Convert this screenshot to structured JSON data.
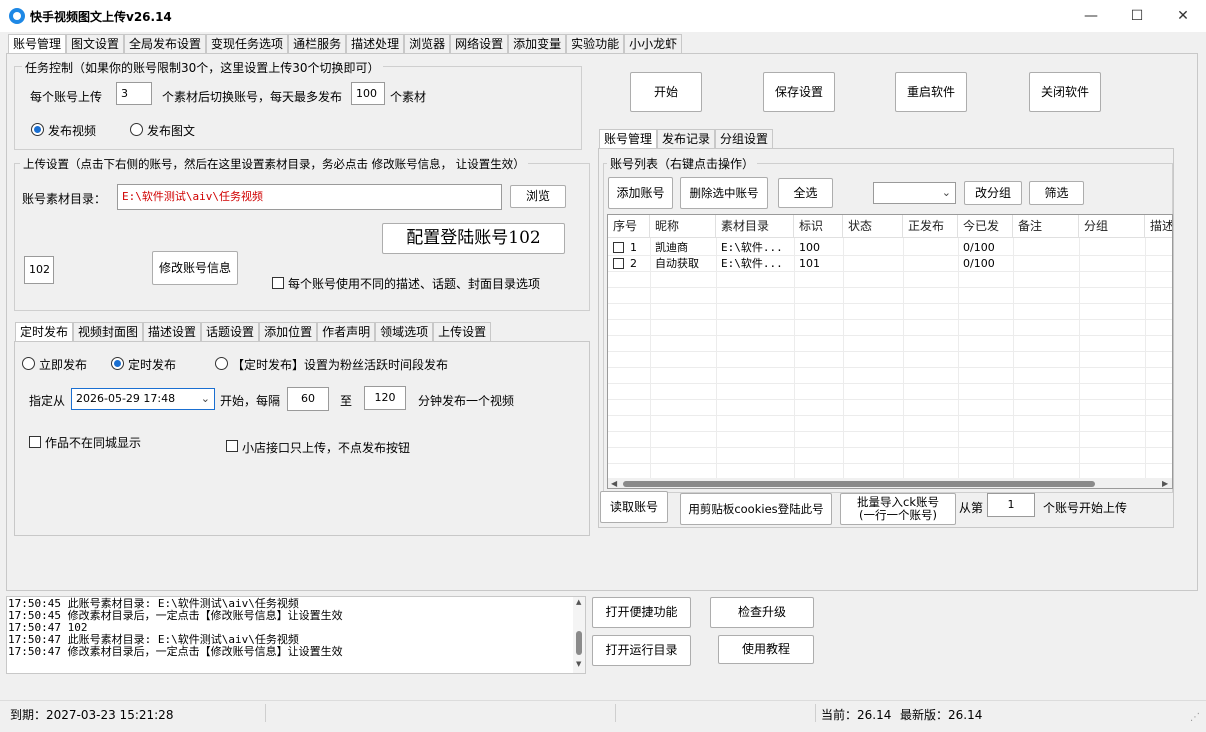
{
  "window": {
    "title": "快手视频图文上传v26.14",
    "minimize": "—",
    "maximize": "☐",
    "close": "✕"
  },
  "main_tabs": [
    "账号管理",
    "图文设置",
    "全局发布设置",
    "变现任务选项",
    "通栏服务",
    "描述处理",
    "浏览器",
    "网络设置",
    "添加变量",
    "实验功能",
    "小小龙虾"
  ],
  "task": {
    "group_title": "任务控制（如果你的账号限制30个，这里设置上传30个切换即可）",
    "per_account_label": "每个账号上传",
    "per_account_value": "3",
    "switch_label": "个素材后切换账号，每天最多发布",
    "daily_max_value": "100",
    "unit_label": "个素材",
    "radio_video": "发布视频",
    "radio_image": "发布图文"
  },
  "upload": {
    "group_title": "上传设置（点击下右侧的账号，然后在这里设置素材目录，务必点击 修改账号信息， 让设置生效）",
    "dir_label": "账号素材目录：",
    "dir_value": "E:\\软件测试\\aiv\\任务视频",
    "browse": "浏览",
    "config_label": "配置登陆账号102",
    "id_value": "102",
    "modify": "修改账号信息",
    "diff_option": "每个账号使用不同的描述、话题、封面目录选项"
  },
  "sub_tabs": [
    "定时发布",
    "视频封面图",
    "描述设置",
    "话题设置",
    "添加位置",
    "作者声明",
    "领域选项",
    "上传设置"
  ],
  "schedule": {
    "radio_now": "立即发布",
    "radio_timed": "定时发布",
    "radio_fans": "【定时发布】设置为粉丝活跃时间段发布",
    "from_label": "指定从",
    "datetime": "2026-05-29 17:48",
    "start_label": "开始，每隔",
    "interval_from": "60",
    "to_label": "至",
    "interval_to": "120",
    "minute_label": "分钟发布一个视频",
    "no_city": "作品不在同城显示",
    "shop_only": "小店接口只上传，不点发布按钮"
  },
  "actions": {
    "start": "开始",
    "save": "保存设置",
    "restart": "重启软件",
    "close": "关闭软件"
  },
  "right_tabs": [
    "账号管理",
    "发布记录",
    "分组设置"
  ],
  "account_list": {
    "title": "账号列表（右键点击操作）",
    "add": "添加账号",
    "delete": "删除选中账号",
    "select_all": "全选",
    "group_select": "",
    "change_group": "改分组",
    "filter": "筛选",
    "columns": [
      "序号",
      "昵称",
      "素材目录",
      "标识",
      "状态",
      "正发布",
      "今已发",
      "备注",
      "分组",
      "描述"
    ],
    "rows": [
      {
        "no": "1",
        "nick": "凯迪商",
        "dir": "E:\\软件...",
        "id": "100",
        "status": "",
        "publishing": "",
        "today": "0/100",
        "note": "",
        "group": ""
      },
      {
        "no": "2",
        "nick": "自动获取",
        "dir": "E:\\软件...",
        "id": "101",
        "status": "",
        "publishing": "",
        "today": "0/100",
        "note": "",
        "group": ""
      }
    ]
  },
  "account_actions": {
    "read": "读取账号",
    "clipboard": "用剪贴板cookies登陆此号",
    "batch_line1": "批量导入ck账号",
    "batch_line2": "(一行一个账号)",
    "from_label": "从第",
    "from_value": "1",
    "from_suffix": "个账号开始上传"
  },
  "log": [
    "17:50:45 此账号素材目录: E:\\软件测试\\aiv\\任务视频",
    "17:50:45 修改素材目录后，一定点击【修改账号信息】让设置生效",
    "17:50:47 102",
    "17:50:47 此账号素材目录: E:\\软件测试\\aiv\\任务视频",
    "17:50:47 修改素材目录后，一定点击【修改账号信息】让设置生效"
  ],
  "tools": {
    "shortcut": "打开便捷功能",
    "upgrade": "检查升级",
    "run_dir": "打开运行目录",
    "tutorial": "使用教程"
  },
  "status": {
    "expiry": "到期：2027-03-23 15:21:28",
    "current": "当前：26.14",
    "latest": "最新版：26.14"
  }
}
